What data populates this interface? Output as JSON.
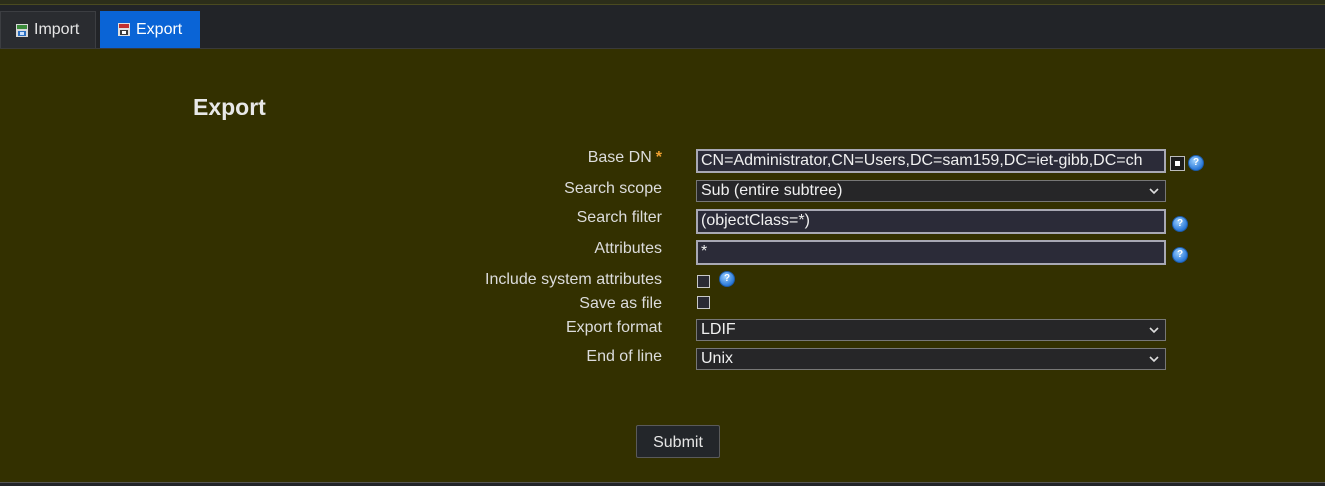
{
  "tabs": [
    {
      "label": "Import",
      "icon": "import-icon",
      "active": false
    },
    {
      "label": "Export",
      "icon": "export-icon",
      "active": true
    }
  ],
  "page_title": "Export",
  "form": {
    "base_dn": {
      "label": "Base DN",
      "required_mark": "*",
      "value": "CN=Administrator,CN=Users,DC=sam159,DC=iet-gibb,DC=ch"
    },
    "search_scope": {
      "label": "Search scope",
      "value": "Sub (entire subtree)"
    },
    "search_filter": {
      "label": "Search filter",
      "value": "(objectClass=*)"
    },
    "attributes": {
      "label": "Attributes",
      "value": "*"
    },
    "include_system_attributes": {
      "label": "Include system attributes",
      "checked": false
    },
    "save_as_file": {
      "label": "Save as file",
      "checked": false
    },
    "export_format": {
      "label": "Export format",
      "value": "LDIF"
    },
    "end_of_line": {
      "label": "End of line",
      "value": "Unix"
    }
  },
  "submit_label": "Submit",
  "colors": {
    "panel_bg": "#333000",
    "active_tab": "#0a64d6",
    "required": "#f0a030",
    "help_icon": "#2a78d8"
  }
}
